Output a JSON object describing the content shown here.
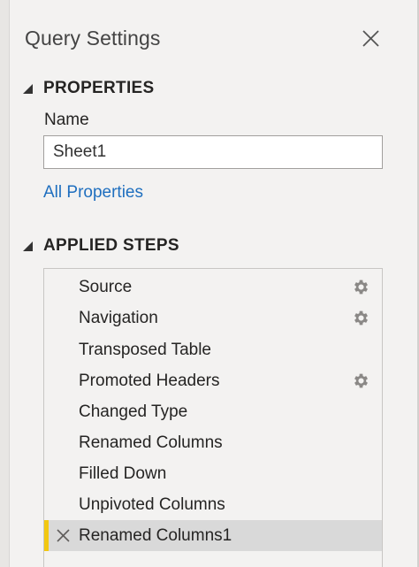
{
  "panel": {
    "title": "Query Settings"
  },
  "properties": {
    "header": "PROPERTIES",
    "name_label": "Name",
    "name_value": "Sheet1",
    "all_properties_link": "All Properties"
  },
  "applied_steps": {
    "header": "APPLIED STEPS",
    "items": [
      {
        "label": "Source",
        "has_settings": true
      },
      {
        "label": "Navigation",
        "has_settings": true
      },
      {
        "label": "Transposed Table",
        "has_settings": false
      },
      {
        "label": "Promoted Headers",
        "has_settings": true
      },
      {
        "label": "Changed Type",
        "has_settings": false
      },
      {
        "label": "Renamed Columns",
        "has_settings": false
      },
      {
        "label": "Filled Down",
        "has_settings": false
      },
      {
        "label": "Unpivoted Columns",
        "has_settings": false
      },
      {
        "label": "Renamed Columns1",
        "has_settings": false,
        "selected": true
      }
    ]
  },
  "colors": {
    "link": "#1f6fbf",
    "selected_marker": "#f2c811",
    "selected_row": "#d9d9d9"
  },
  "icons": {
    "close": "close-icon",
    "collapse": "triangle-down-icon",
    "settings": "gear-icon",
    "delete": "delete-step-icon"
  }
}
